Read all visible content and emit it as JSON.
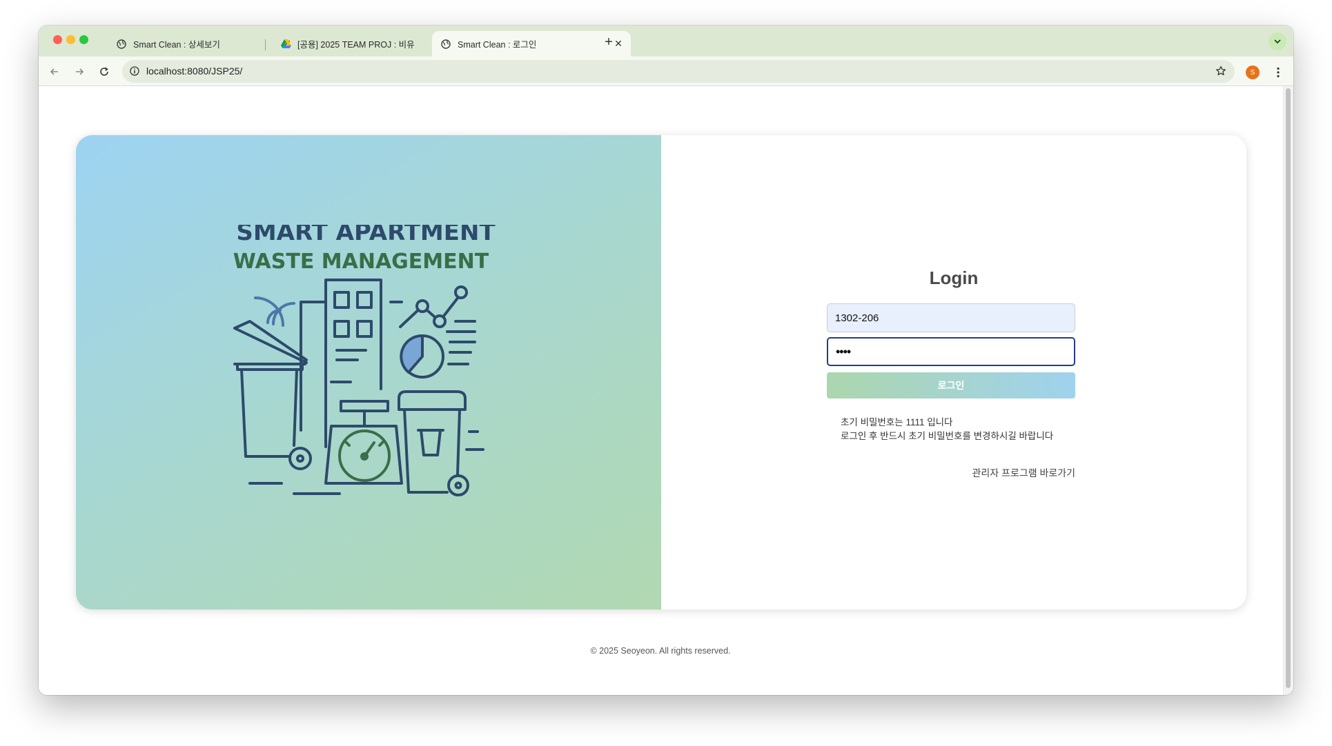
{
  "browser": {
    "tabs": [
      {
        "title": "Smart Clean : 상세보기",
        "active": false
      },
      {
        "title": "[공용] 2025 TEAM PROJ : 비유",
        "active": false
      },
      {
        "title": "Smart Clean : 로그인",
        "active": true
      }
    ],
    "new_tab_label": "+",
    "url": "localhost:8080/JSP25/",
    "profile_initial": "S"
  },
  "hero": {
    "title_line1": "SMART APARTMENT",
    "title_line2": "WASTE MANAGEMENT"
  },
  "login": {
    "title": "Login",
    "id_value": "1302-206",
    "password_mask": "••••",
    "button_label": "로그인",
    "notice_line1": "초기 비밀번호는 1111 입니다",
    "notice_line2": "로그인 후 반드시 초기 비밀번호를 변경하시길 바랍니다",
    "admin_link": "관리자 프로그램 바로가기"
  },
  "footer": {
    "text": "© 2025 Seoyeon. All rights reserved."
  },
  "colors": {
    "tabbar": "#dde8d2",
    "navy": "#2d4a6b",
    "green": "#3a6e48",
    "input_focus": "#1f3e84"
  }
}
